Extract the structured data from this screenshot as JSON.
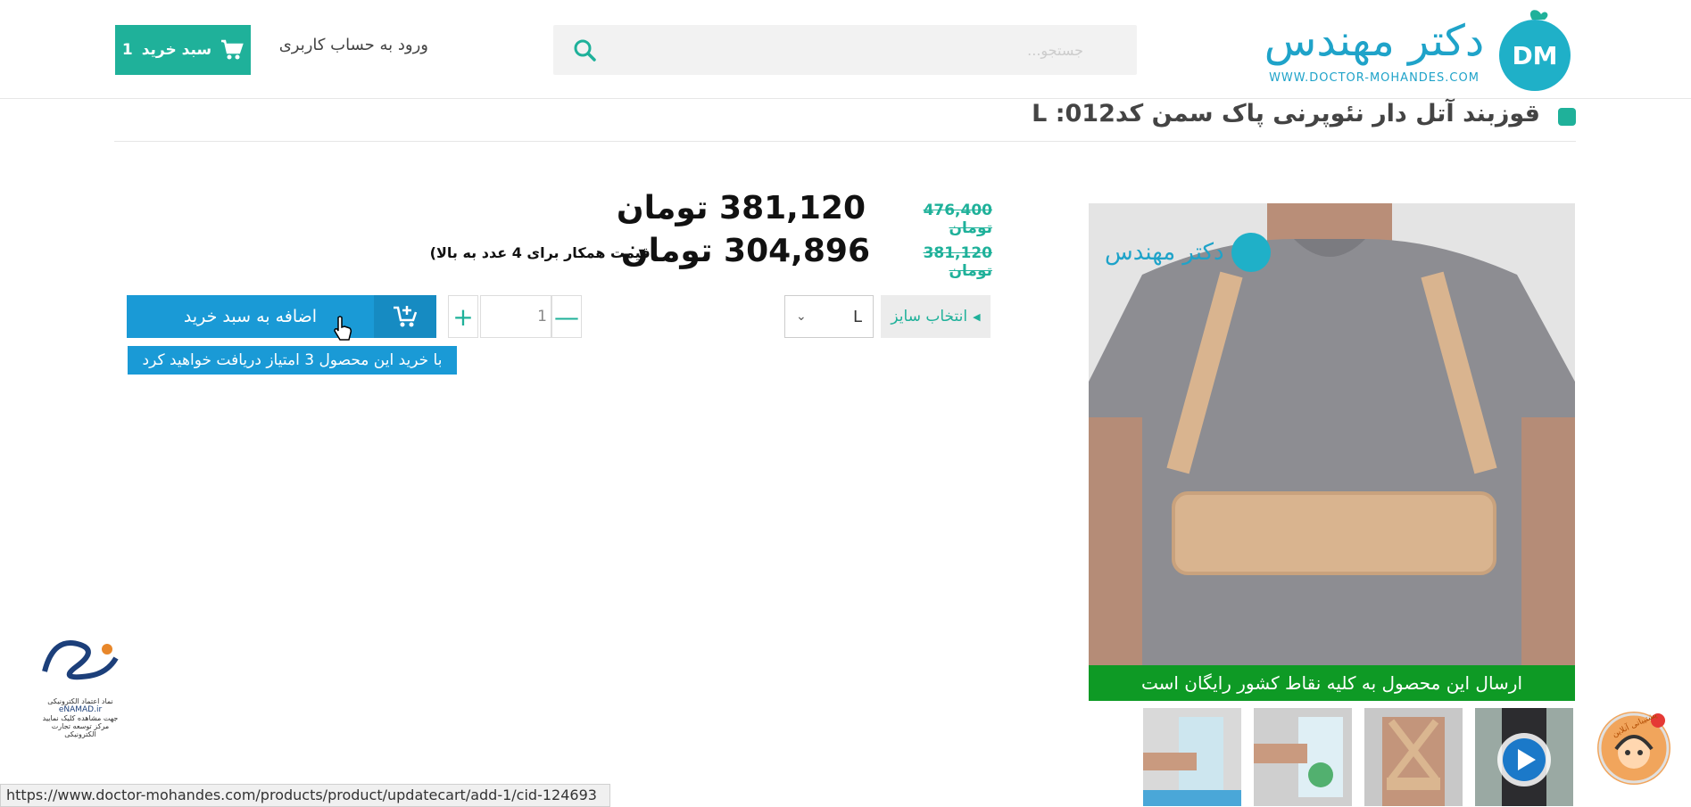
{
  "header": {
    "logo_text": "دکتر مهندس",
    "logo_url_text": "WWW.DOCTOR-MOHANDES.COM",
    "search_placeholder": "جستجو...",
    "login_label": "ورود به حساب کاربری",
    "cart_label": "سبد خرید",
    "cart_count": "1"
  },
  "product": {
    "title": "قوزبند آتل دار نئوپرنی پاک سمن کد012: L",
    "watermark_text": "دکتر مهندس",
    "shipping_banner": "ارسال این محصول به کلیه نقاط کشور رایگان است"
  },
  "prices": {
    "row1_old": "476,400 تومان",
    "row1_new": "381,120 تومان",
    "row2_old": "381,120 تومان",
    "row2_new": "304,896 تومان",
    "row2_note": "(قیمت همکار برای 4 عدد به بالا)"
  },
  "purchase": {
    "size_label": "انتخاب سایز",
    "size_value": "L",
    "quantity": "1",
    "add_to_cart": "اضافه به سبد خرید",
    "points_note": "با خرید این محصول 3 امتیاز دریافت خواهید کرد"
  },
  "enamad": {
    "brand": "eNAMAD.ir",
    "line1": "نماد اعتماد الکترونیکی",
    "line2": "جهت مشاهده کلیک نمایید",
    "line3": "مرکز توسعه تجارت الکترونیکی"
  },
  "status_bar": "https://www.doctor-mohandes.com/products/product/updatecart/add-1/cid-124693",
  "support_label": "پشتیبانی آنلاین",
  "colors": {
    "accent": "#1fb19a",
    "blue": "#1a9ad6",
    "green_banner": "#0e9a25"
  }
}
